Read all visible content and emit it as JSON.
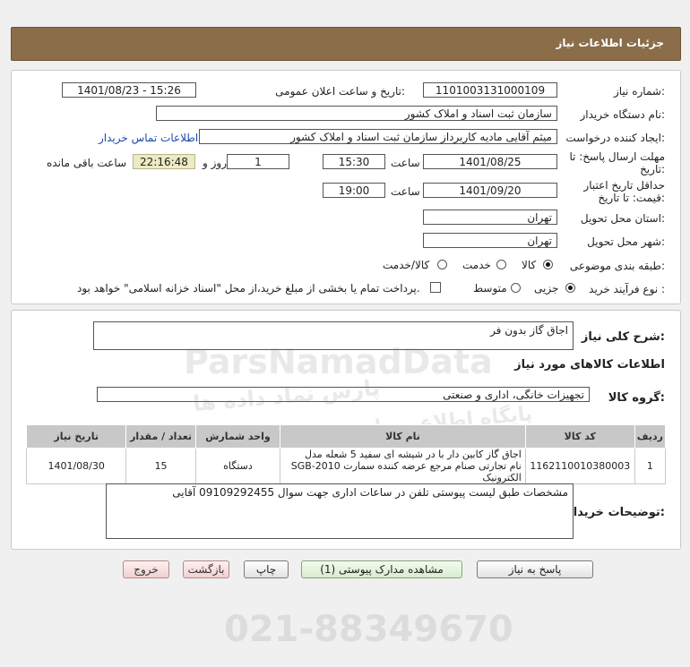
{
  "header": {
    "title": "جزئیات اطلاعات نیاز"
  },
  "form": {
    "need_number_label": "شماره نیاز:",
    "need_number": "1101003131000109",
    "announce_label": "تاریخ و ساعت اعلان عمومی:",
    "announce_value": "1401/08/23 - 15:26",
    "buyer_label": "نام دستگاه خریدار:",
    "buyer_value": "سازمان ثبت اسناد و املاک کشور",
    "creator_label": "ایجاد کننده درخواست:",
    "creator_value": "میثم آقایی مادیه کاربرداز سازمان ثبت اسناد و املاک کشور",
    "contact_link": "اطلاعات تماس خریدار",
    "reply_deadline_label": "مهلت ارسال پاسخ: تا تاریخ:",
    "reply_date": "1401/08/25",
    "time_label": "ساعت",
    "reply_time": "15:30",
    "days_value": "1",
    "days_label": "روز و",
    "remaining_time": "22:16:48",
    "remaining_label": "ساعت باقی مانده",
    "validity_label": "حداقل تاریخ اعتبار قیمت: تا تاریخ:",
    "validity_date": "1401/09/20",
    "validity_time": "19:00",
    "province_label": "استان محل تحویل:",
    "province_value": "تهران",
    "city_label": "شهر محل تحویل:",
    "city_value": "تهران",
    "category_label": "طبقه بندی موضوعی:",
    "category_options": [
      "کالا",
      "خدمت",
      "کالا/خدمت"
    ],
    "category_selected": "کالا",
    "process_label": "نوع فرآیند خرید :",
    "process_options": [
      "جزیی",
      "متوسط"
    ],
    "process_selected": "جزیی",
    "payment_note": "پرداخت تمام یا بخشی از مبلغ خرید،از محل \"اسناد خزانه اسلامی\" خواهد بود."
  },
  "details": {
    "summary_label": "شرح کلی نیاز:",
    "summary_value": "اجاق گاز بدون فر",
    "goods_info_title": "اطلاعات کالاهای مورد نیاز",
    "goods_group_label": "گروه کالا:",
    "goods_group_value": "تجهیزات خانگی، اداری و صنعتی",
    "table": {
      "headers": [
        "ردیف",
        "کد کالا",
        "نام کالا",
        "واحد شمارش",
        "تعداد / مقدار",
        "تاریخ نیاز"
      ],
      "rows": [
        {
          "index": "1",
          "code": "1162110010380003",
          "name": "اجاق گاز کابین دار با در شیشه ای سفید 5 شعله مدل SGB-2010 نام تجارتی صنام مرجع عرضه کننده سمارت الکترونیک",
          "unit": "دستگاه",
          "qty": "15",
          "date": "1401/08/30"
        }
      ]
    },
    "buyer_notes_label": "توضیحات خریدار:",
    "buyer_notes_value": "مشخصات طبق لیست پیوستی تلفن در ساعات اداری جهت سوال 09109292455 آقایی"
  },
  "watermark": {
    "brand": "ParsNamadData",
    "line1": "پایگاه اطلاع رسانی مناقصات و مزایده",
    "line2": "پارس نماد داده ها",
    "phone": "021-88349670"
  },
  "buttons": {
    "reply": "پاسخ به نیاز",
    "attachments": "مشاهده مدارک پیوستی (1)",
    "print": "چاپ",
    "back": "بازگشت",
    "exit": "خروج"
  }
}
